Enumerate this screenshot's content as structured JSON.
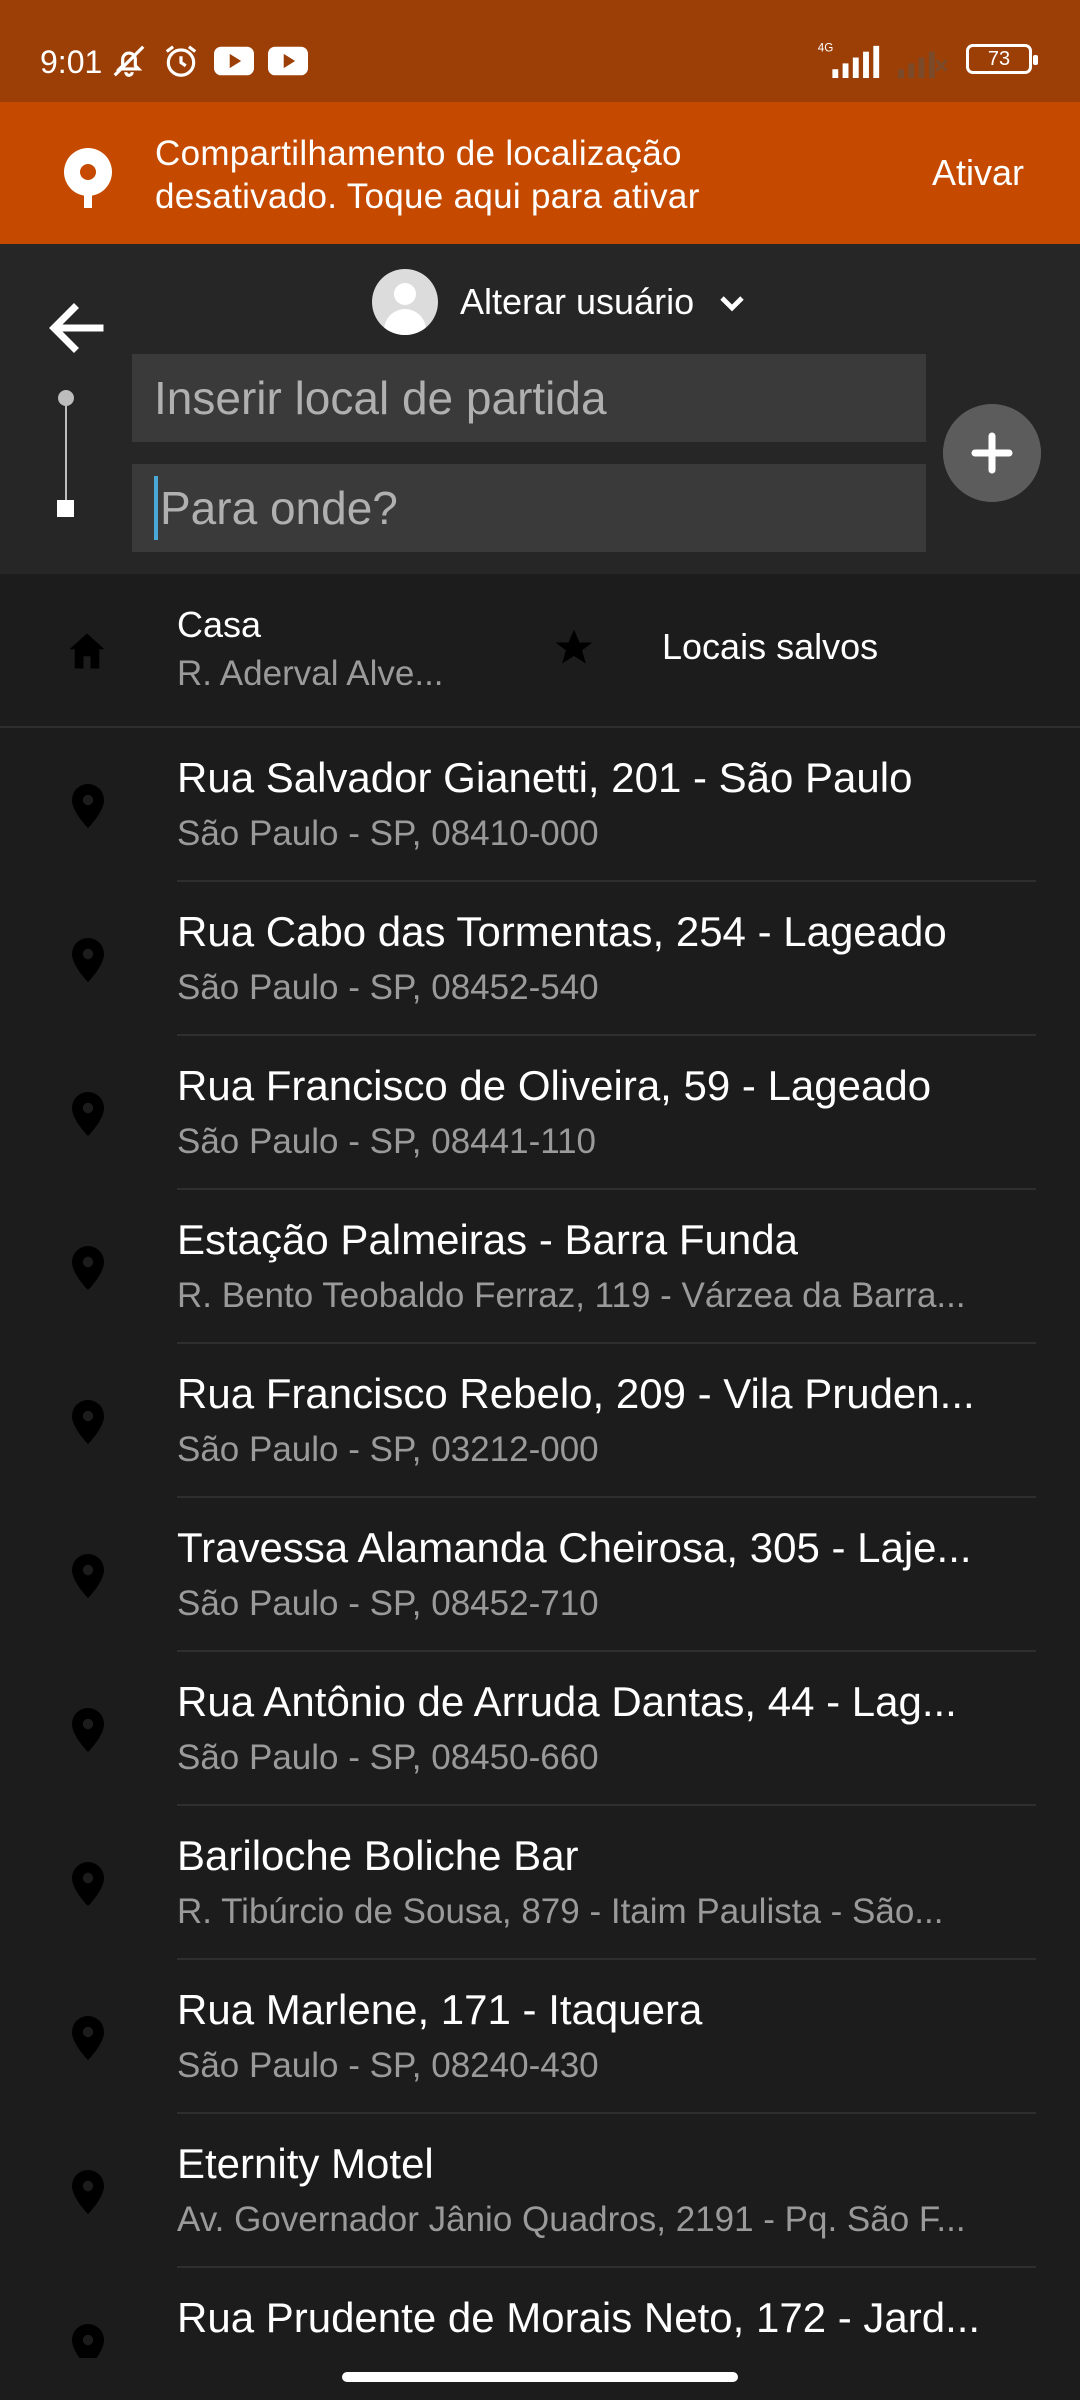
{
  "status_bar": {
    "time": "9:01",
    "network": "4G",
    "battery": "73",
    "icons_left": [
      "muted-bell-icon",
      "alarm-icon",
      "youtube-icon",
      "youtube-icon"
    ],
    "icons_right": [
      "signal-icon",
      "signal-off-icon",
      "battery-icon"
    ]
  },
  "banner": {
    "text": "Compartilhamento de localização desativado. Toque aqui para ativar",
    "action": "Ativar",
    "color": "#c54a00"
  },
  "header": {
    "user_label": "Alterar usuário",
    "pickup_placeholder": "Inserir local de partida",
    "destination_placeholder": "Para onde?"
  },
  "saved": {
    "home_title": "Casa",
    "home_address": "R. Aderval Alve...",
    "saved_places_label": "Locais salvos"
  },
  "recent_places": [
    {
      "title": "Rua Salvador Gianetti, 201 - São Paulo",
      "subtitle": "São Paulo - SP, 08410-000"
    },
    {
      "title": "Rua Cabo das Tormentas, 254 - Lageado",
      "subtitle": "São Paulo - SP, 08452-540"
    },
    {
      "title": "Rua Francisco de Oliveira, 59 - Lageado",
      "subtitle": "São Paulo - SP, 08441-110"
    },
    {
      "title": "Estação Palmeiras - Barra Funda",
      "subtitle": "R. Bento Teobaldo Ferraz, 119 - Várzea da Barra..."
    },
    {
      "title": "Rua Francisco Rebelo, 209 - Vila Pruden...",
      "subtitle": "São Paulo - SP, 03212-000"
    },
    {
      "title": "Travessa Alamanda Cheirosa, 305 - Laje...",
      "subtitle": "São Paulo - SP, 08452-710"
    },
    {
      "title": "Rua Antônio de Arruda Dantas, 44 - Lag...",
      "subtitle": "São Paulo - SP, 08450-660"
    },
    {
      "title": "Bariloche Boliche Bar",
      "subtitle": "R. Tibúrcio de Sousa, 879 - Itaim Paulista - São..."
    },
    {
      "title": "Rua Marlene, 171 - Itaquera",
      "subtitle": "São Paulo - SP, 08240-430"
    },
    {
      "title": "Eternity Motel",
      "subtitle": "Av. Governador Jânio Quadros, 2191 - Pq. São F..."
    },
    {
      "title": "Rua Prudente de Morais Neto, 172 - Jard...",
      "subtitle": ""
    }
  ]
}
